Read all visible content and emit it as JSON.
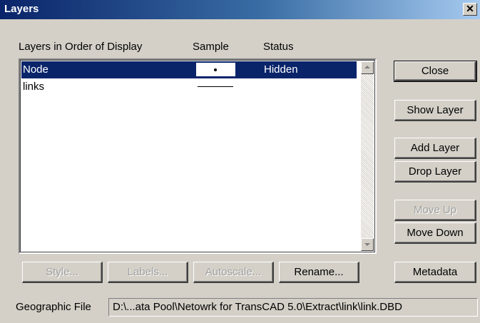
{
  "window": {
    "title": "Layers",
    "close_glyph": "✕"
  },
  "columns": {
    "layers": "Layers in Order of Display",
    "sample": "Sample",
    "status": "Status"
  },
  "layers": [
    {
      "name": "Node",
      "status": "Hidden",
      "sample": "point",
      "selected": true
    },
    {
      "name": "links",
      "status": "",
      "sample": "line",
      "selected": false
    }
  ],
  "right_buttons": {
    "close": "Close",
    "show_layer": "Show Layer",
    "add_layer": "Add Layer",
    "drop_layer": "Drop Layer",
    "move_up": "Move Up",
    "move_down": "Move Down",
    "metadata": "Metadata"
  },
  "bottom_buttons": {
    "style": "Style...",
    "labels": "Labels...",
    "autoscale": "Autoscale...",
    "rename": "Rename..."
  },
  "geographic_file": {
    "label": "Geographic File",
    "value": "D:\\...ata Pool\\Netowrk for TransCAD 5.0\\Extract\\link\\link.DBD"
  },
  "colors": {
    "selection": "#0a246a",
    "face": "#d4d0c8"
  }
}
